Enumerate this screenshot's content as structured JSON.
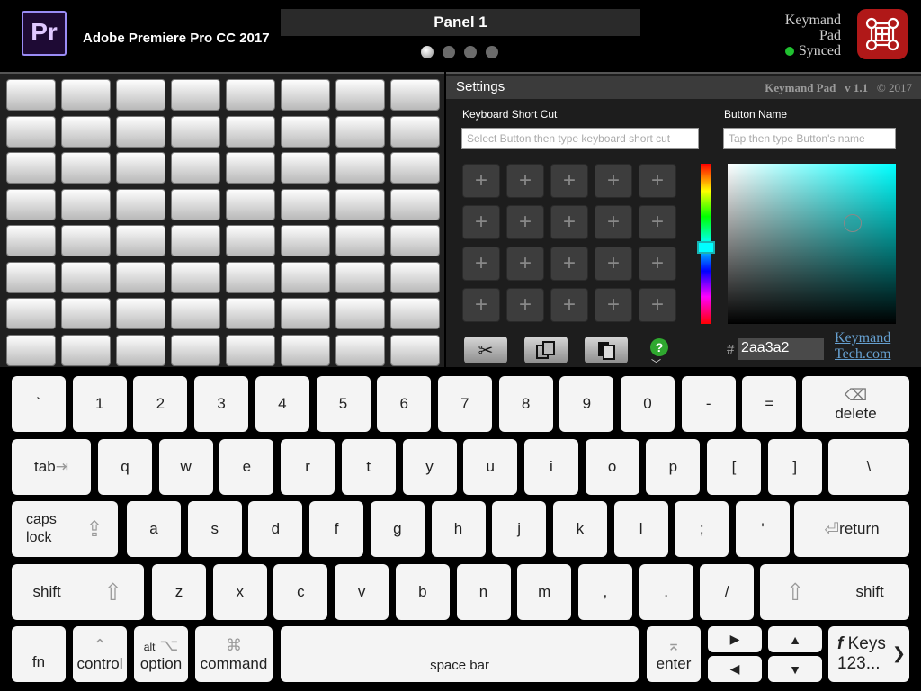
{
  "header": {
    "app_icon_text": "Pr",
    "app_name": "Adobe Premiere Pro CC 2017",
    "panel_title": "Panel 1",
    "page_count": 4,
    "active_page": 0,
    "brand_line1": "Keymand",
    "brand_line2": "Pad",
    "sync_status": "Synced",
    "sync_color": "#20c030",
    "logo_color": "#b01818"
  },
  "grid": {
    "rows": 8,
    "cols": 8
  },
  "settings": {
    "title": "Settings",
    "brand": "Keymand Pad",
    "version": "v 1.1",
    "copyright": "© 2017",
    "shortcut_label": "Keyboard Short Cut",
    "shortcut_placeholder": "Select Button then type keyboard short cut",
    "name_label": "Button Name",
    "name_placeholder": "Tap then type Button's name",
    "plus_symbol": "+",
    "hash": "#",
    "color_hex": "2aa3a2",
    "link_line1": "Keymand",
    "link_line2": "Tech.com",
    "help_symbol": "?",
    "tools": [
      "scissors-icon",
      "copy-icon",
      "paste-icon",
      "help-icon"
    ]
  },
  "keyboard": {
    "row1": [
      "`",
      "1",
      "2",
      "3",
      "4",
      "5",
      "6",
      "7",
      "8",
      "9",
      "0",
      "-",
      "=",
      "delete"
    ],
    "row2": [
      "tab",
      "q",
      "w",
      "e",
      "r",
      "t",
      "y",
      "u",
      "i",
      "o",
      "p",
      "[",
      "]",
      "\\"
    ],
    "row3": [
      "caps",
      "lock",
      "a",
      "s",
      "d",
      "f",
      "g",
      "h",
      "j",
      "k",
      "l",
      ";",
      "'",
      "return"
    ],
    "row4": [
      "shift",
      "z",
      "x",
      "c",
      "v",
      "b",
      "n",
      "m",
      ",",
      ".",
      "/",
      "shift"
    ],
    "row5": {
      "fn": "fn",
      "control": "control",
      "option_alt": "alt",
      "option": "option",
      "command": "command",
      "space": "space bar",
      "enter": "enter",
      "fkeys_line1": "Keys",
      "fkeys_f": "f",
      "fkeys_line2": "123..."
    }
  }
}
